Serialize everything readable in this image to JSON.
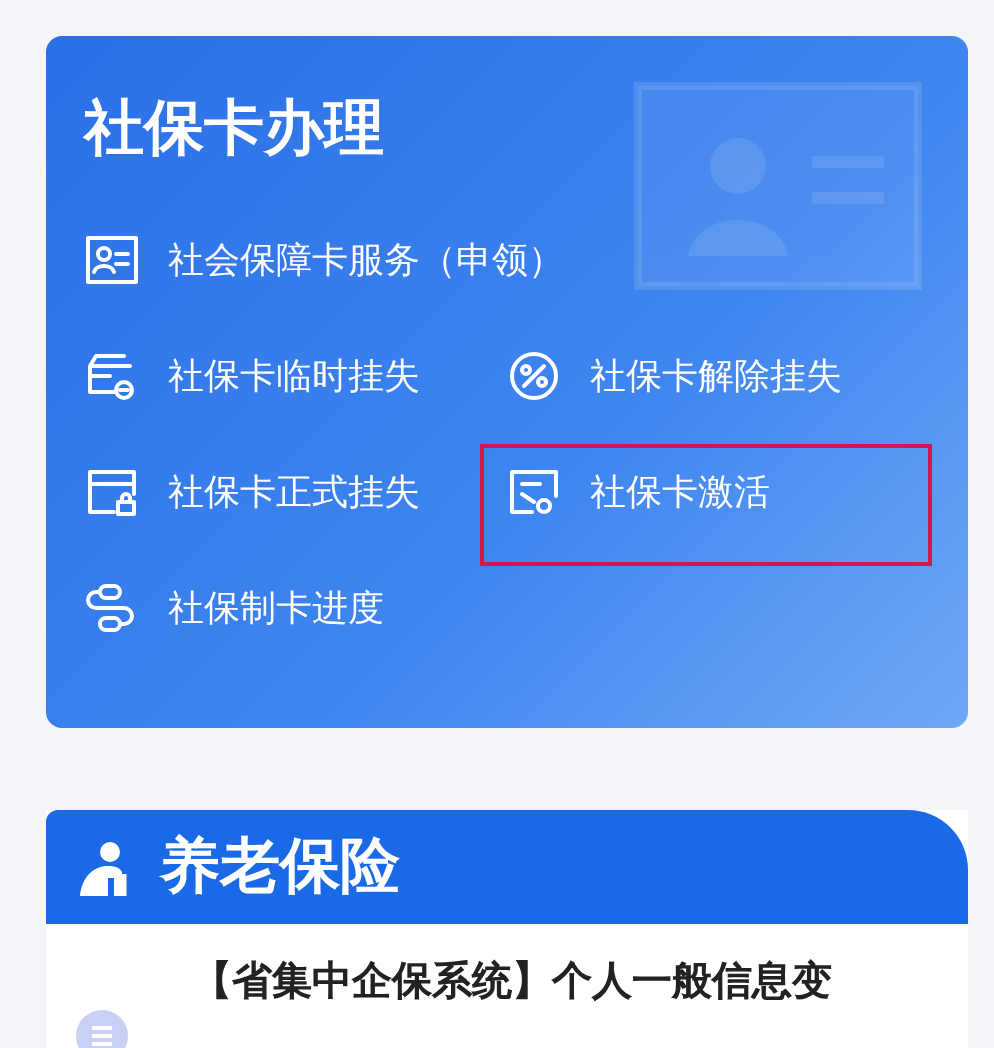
{
  "card_service": {
    "title": "社保卡办理",
    "rows": [
      [
        {
          "label": "社会保障卡服务（申领）",
          "highlighted": false
        }
      ],
      [
        {
          "label": "社保卡临时挂失",
          "highlighted": false
        },
        {
          "label": "社保卡解除挂失",
          "highlighted": false
        }
      ],
      [
        {
          "label": "社保卡正式挂失",
          "highlighted": false
        },
        {
          "label": "社保卡激活",
          "highlighted": true
        }
      ],
      [
        {
          "label": "社保制卡进度",
          "highlighted": false
        }
      ]
    ]
  },
  "pension": {
    "title": "养老保险",
    "items": [
      {
        "label": "【省集中企保系统】个人一般信息变"
      }
    ]
  }
}
